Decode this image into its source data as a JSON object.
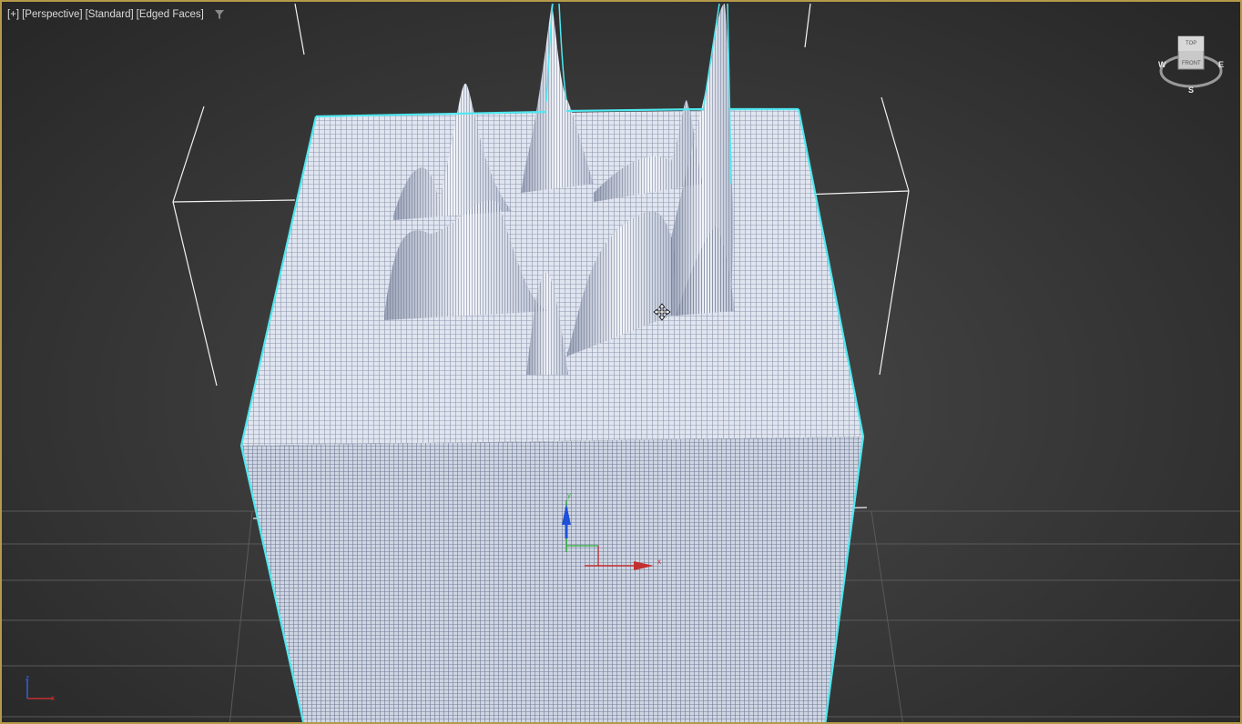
{
  "viewport": {
    "labels": [
      "[+]",
      "[Perspective]",
      "[Standard]",
      "[Edged Faces]"
    ],
    "border_color": "#b69a4a",
    "background_color": "#3a3a3a"
  },
  "icons": {
    "filter": "filter-funnel-icon",
    "move_cursor": "move-cursor-icon",
    "viewcube": "viewcube-icon",
    "world_axis": "world-axis-tripod-icon",
    "transform_gizmo": "transform-gizmo-icon"
  },
  "viewcube": {
    "top_face": "TOP",
    "front_face": "FRONT",
    "compass": {
      "west": "W",
      "east": "E",
      "south": "S"
    }
  },
  "gizmo": {
    "x_label": "x",
    "y_label": "y"
  },
  "world_axis": {
    "z_label": "z",
    "x_label": "x"
  },
  "colors": {
    "selection_outline": "#4fe8f0",
    "mesh_face": "#dfe4ee",
    "wire": "#8e97ae",
    "axis_x": "#c43030",
    "axis_y": "#2fae3a",
    "axis_z": "#1e50d8"
  }
}
